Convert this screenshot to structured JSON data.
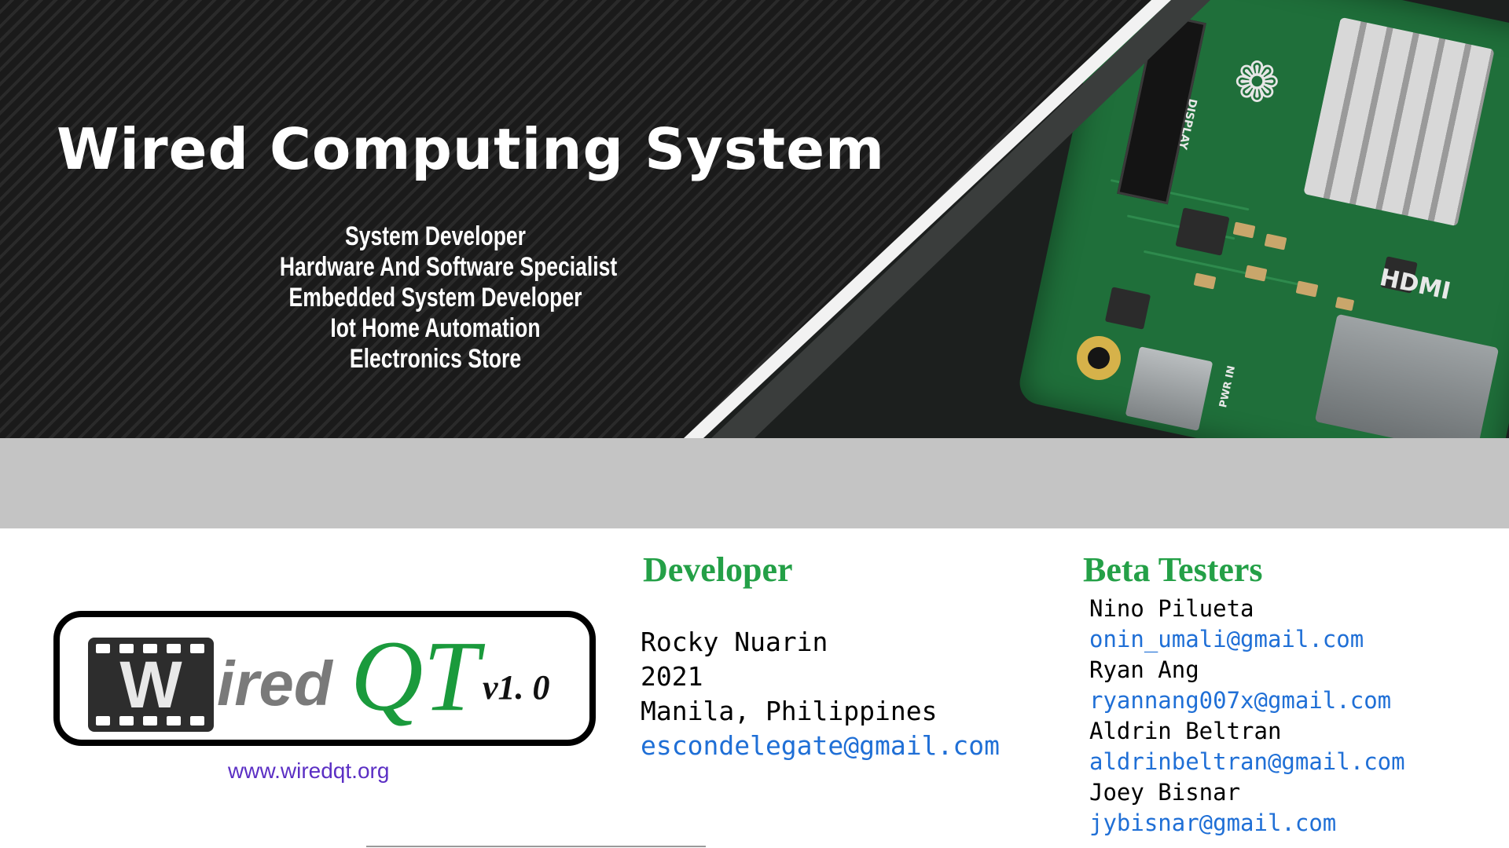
{
  "banner": {
    "title": "Wired Computing System",
    "services": [
      "System Developer",
      "Hardware And Software Specialist",
      "Embedded System Developer",
      "Iot Home Automation",
      "Electronics Store"
    ],
    "board_labels": {
      "display": "DISPLAY",
      "hdmi": "HDMI",
      "pwr": "PWR IN"
    }
  },
  "logo": {
    "letter": "W",
    "ired": "ired",
    "qt": "QT",
    "version": "v1. 0",
    "url": "www.wiredqt.org"
  },
  "developer": {
    "heading": "Developer",
    "name": "Rocky Nuarin",
    "year": "2021",
    "location": "Manila, Philippines",
    "email": "escondelegate@gmail.com"
  },
  "beta_testers": {
    "heading": "Beta Testers",
    "people": [
      {
        "name": "Nino Pilueta",
        "email": "onin_umali@gmail.com"
      },
      {
        "name": "Ryan Ang",
        "email": "ryannang007x@gmail.com"
      },
      {
        "name": "Aldrin Beltran",
        "email": "aldrinbeltran@gmail.com"
      },
      {
        "name": "Joey Bisnar",
        "email": "jybisnar@gmail.com"
      }
    ]
  },
  "colors": {
    "heading_green": "#24a047",
    "link_blue": "#1f6fd6",
    "url_purple": "#5b2fc4",
    "band_gray": "#c4c4c4"
  }
}
